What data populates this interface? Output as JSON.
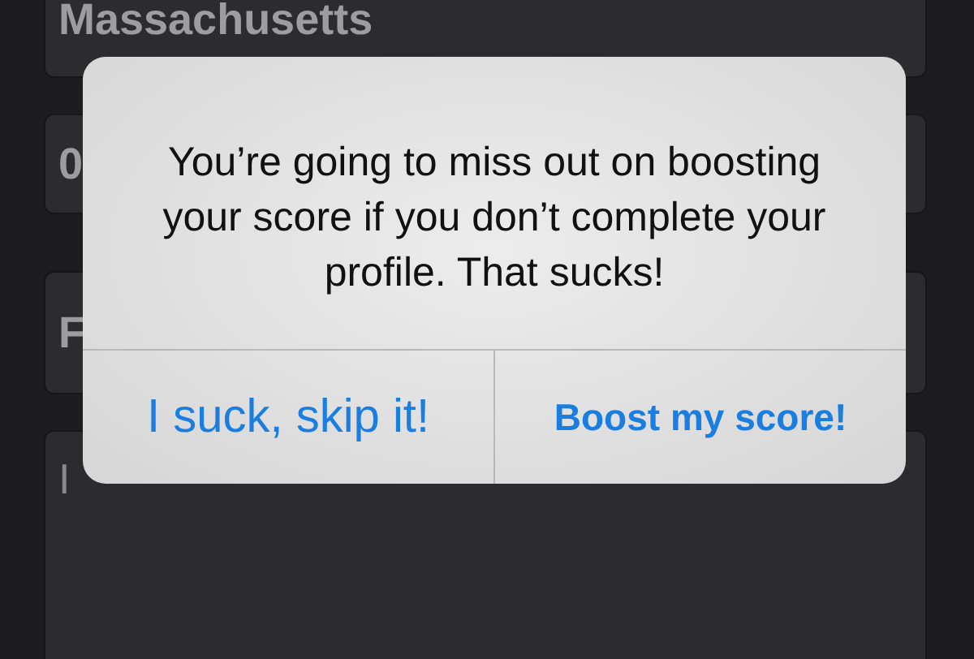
{
  "fields": [
    {
      "kind": "value",
      "text": "Massachusetts"
    },
    {
      "kind": "value",
      "text": "0"
    },
    {
      "kind": "value",
      "text": "F"
    },
    {
      "kind": "textarea",
      "text": "I"
    }
  ],
  "alert": {
    "message": "You’re going to miss out on boosting your score if you don’t complete your profile. That sucks!",
    "buttons": [
      {
        "label": "I suck, skip it!",
        "primary": false
      },
      {
        "label": "Boost my score!",
        "primary": true
      }
    ]
  }
}
